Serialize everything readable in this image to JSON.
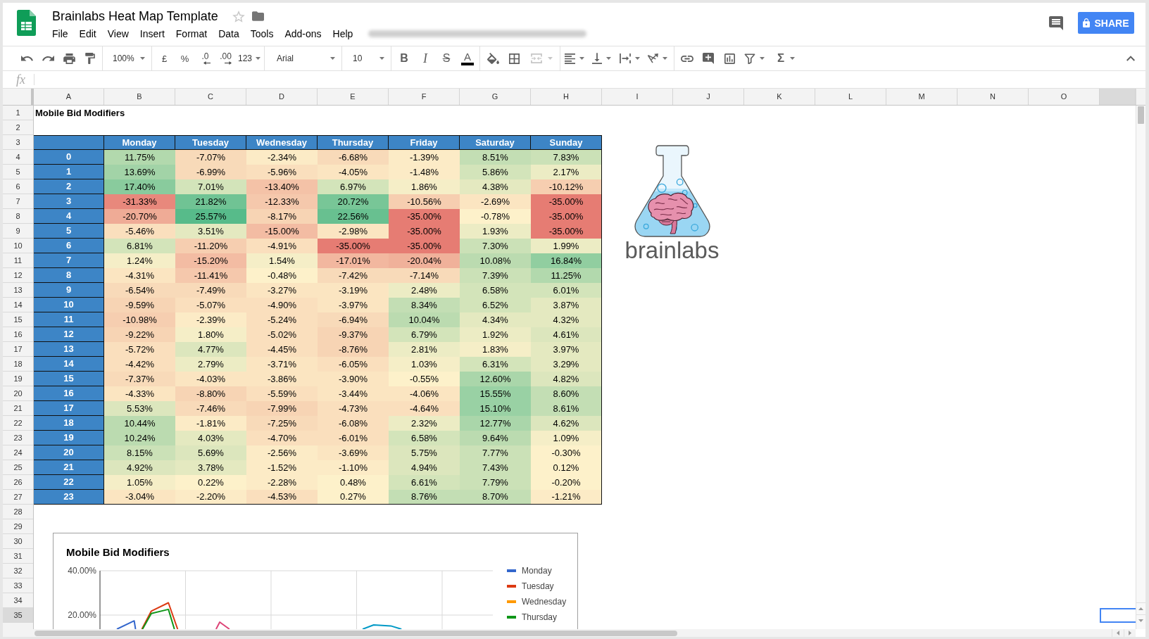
{
  "app": {
    "title": "Brainlabs Heat Map Template",
    "starred": false,
    "share_label": "SHARE"
  },
  "menu": [
    "File",
    "Edit",
    "View",
    "Insert",
    "Format",
    "Data",
    "Tools",
    "Add-ons",
    "Help"
  ],
  "toolbar": {
    "zoom": "100%",
    "currency": "£",
    "percent": "%",
    "decrease_decimals": ".0",
    "increase_decimals": ".00",
    "number_format": "123",
    "font": "Arial",
    "font_size": "10",
    "bold": "B",
    "italic": "I",
    "strikethrough": "S",
    "text_color": "A",
    "merge_disabled": true,
    "functions": "Σ"
  },
  "formula_bar": {
    "label": "fx"
  },
  "sheet": {
    "columns": [
      {
        "label": "A",
        "selected": false
      },
      {
        "label": "B",
        "selected": false
      },
      {
        "label": "C",
        "selected": false
      },
      {
        "label": "D",
        "selected": false
      },
      {
        "label": "E",
        "selected": false
      },
      {
        "label": "F",
        "selected": false
      },
      {
        "label": "G",
        "selected": false
      },
      {
        "label": "H",
        "selected": false
      },
      {
        "label": "I",
        "selected": false
      },
      {
        "label": "J",
        "selected": false
      },
      {
        "label": "K",
        "selected": false
      },
      {
        "label": "L",
        "selected": false
      },
      {
        "label": "M",
        "selected": false
      },
      {
        "label": "N",
        "selected": false
      },
      {
        "label": "O",
        "selected": false
      },
      {
        "selected": true
      }
    ],
    "rows": [
      {
        "label": "1",
        "selected": false
      },
      {
        "label": "2",
        "selected": false
      },
      {
        "label": "3",
        "selected": false
      },
      {
        "label": "4",
        "selected": false
      },
      {
        "label": "5",
        "selected": false
      },
      {
        "label": "6",
        "selected": false
      },
      {
        "label": "7",
        "selected": false
      },
      {
        "label": "8",
        "selected": false
      },
      {
        "label": "9",
        "selected": false
      },
      {
        "label": "10",
        "selected": false
      },
      {
        "label": "11",
        "selected": false
      },
      {
        "label": "12",
        "selected": false
      },
      {
        "label": "13",
        "selected": false
      },
      {
        "label": "14",
        "selected": false
      },
      {
        "label": "15",
        "selected": false
      },
      {
        "label": "16",
        "selected": false
      },
      {
        "label": "17",
        "selected": false
      },
      {
        "label": "18",
        "selected": false
      },
      {
        "label": "19",
        "selected": false
      },
      {
        "label": "20",
        "selected": false
      },
      {
        "label": "21",
        "selected": false
      },
      {
        "label": "22",
        "selected": false
      },
      {
        "label": "23",
        "selected": false
      },
      {
        "label": "24",
        "selected": false
      },
      {
        "label": "25",
        "selected": false
      },
      {
        "label": "26",
        "selected": false
      },
      {
        "label": "27",
        "selected": false
      },
      {
        "label": "28",
        "selected": false
      },
      {
        "label": "29",
        "selected": false
      },
      {
        "label": "30",
        "selected": false
      },
      {
        "label": "31",
        "selected": false
      },
      {
        "label": "32",
        "selected": false
      },
      {
        "label": "33",
        "selected": false
      },
      {
        "label": "34",
        "selected": false
      },
      {
        "label": "35",
        "selected": true
      }
    ],
    "title_cell": "Mobile Bid Modifiers",
    "heat_table": {
      "headers": [
        "Monday",
        "Tuesday",
        "Wednesday",
        "Thursday",
        "Friday",
        "Saturday",
        "Sunday"
      ],
      "rows": [
        {
          "hour": "0",
          "cells": [
            {
              "value": "11.75%",
              "color": "#b2d9ad"
            },
            {
              "value": "-7.07%",
              "color": "#f8dab9"
            },
            {
              "value": "-2.34%",
              "color": "#fcebc6"
            },
            {
              "value": "-6.68%",
              "color": "#f8dab9"
            },
            {
              "value": "-1.39%",
              "color": "#fcebc6"
            },
            {
              "value": "8.51%",
              "color": "#c3deb4"
            },
            {
              "value": "7.83%",
              "color": "#cbe1b7"
            }
          ]
        },
        {
          "hour": "1",
          "cells": [
            {
              "value": "13.69%",
              "color": "#a2d3a7"
            },
            {
              "value": "-6.99%",
              "color": "#f8dab9"
            },
            {
              "value": "-5.96%",
              "color": "#fadfbd"
            },
            {
              "value": "-4.05%",
              "color": "#fbe5c1"
            },
            {
              "value": "-1.48%",
              "color": "#fcebc6"
            },
            {
              "value": "5.86%",
              "color": "#d3e4ba"
            },
            {
              "value": "2.17%",
              "color": "#ececc4"
            }
          ]
        },
        {
          "hour": "2",
          "cells": [
            {
              "value": "17.40%",
              "color": "#89cb9d"
            },
            {
              "value": "7.01%",
              "color": "#d3e4ba"
            },
            {
              "value": "-13.40%",
              "color": "#f4c2a7"
            },
            {
              "value": "6.97%",
              "color": "#d3e4ba"
            },
            {
              "value": "1.86%",
              "color": "#f5eec7"
            },
            {
              "value": "4.38%",
              "color": "#e4e9c0"
            },
            {
              "value": "-10.12%",
              "color": "#f6ceb0"
            }
          ]
        },
        {
          "hour": "3",
          "cells": [
            {
              "value": "-31.33%",
              "color": "#e8887c"
            },
            {
              "value": "21.82%",
              "color": "#70c394"
            },
            {
              "value": "-12.33%",
              "color": "#f5c8ac"
            },
            {
              "value": "20.72%",
              "color": "#78c697"
            },
            {
              "value": "-10.56%",
              "color": "#f6ceb0"
            },
            {
              "value": "-2.69%",
              "color": "#fbe5c1"
            },
            {
              "value": "-35.00%",
              "color": "#e67c73"
            }
          ]
        },
        {
          "hour": "4",
          "cells": [
            {
              "value": "-20.70%",
              "color": "#efab96"
            },
            {
              "value": "25.57%",
              "color": "#57bb8a"
            },
            {
              "value": "-8.17%",
              "color": "#f7d4b4"
            },
            {
              "value": "22.56%",
              "color": "#68c090"
            },
            {
              "value": "-35.00%",
              "color": "#e67c73"
            },
            {
              "value": "-0.78%",
              "color": "#fdf1ca"
            },
            {
              "value": "-35.00%",
              "color": "#e67c73"
            }
          ]
        },
        {
          "hour": "5",
          "cells": [
            {
              "value": "-5.46%",
              "color": "#fadfbd"
            },
            {
              "value": "3.51%",
              "color": "#e4e9c0"
            },
            {
              "value": "-15.00%",
              "color": "#f3bca3"
            },
            {
              "value": "-2.98%",
              "color": "#fbe5c1"
            },
            {
              "value": "-35.00%",
              "color": "#e67c73"
            },
            {
              "value": "1.93%",
              "color": "#ececc4"
            },
            {
              "value": "-35.00%",
              "color": "#e67c73"
            }
          ]
        },
        {
          "hour": "6",
          "cells": [
            {
              "value": "6.81%",
              "color": "#d3e4ba"
            },
            {
              "value": "-11.20%",
              "color": "#f6ceb0"
            },
            {
              "value": "-4.91%",
              "color": "#fadfbd"
            },
            {
              "value": "-35.00%",
              "color": "#e67c73"
            },
            {
              "value": "-35.00%",
              "color": "#e67c73"
            },
            {
              "value": "7.30%",
              "color": "#cbe1b7"
            },
            {
              "value": "1.99%",
              "color": "#ececc4"
            }
          ]
        },
        {
          "hour": "7",
          "cells": [
            {
              "value": "1.24%",
              "color": "#f5eec7"
            },
            {
              "value": "-15.20%",
              "color": "#f3bca3"
            },
            {
              "value": "1.54%",
              "color": "#f5eec7"
            },
            {
              "value": "-17.01%",
              "color": "#f2b79f"
            },
            {
              "value": "-20.04%",
              "color": "#f0b19a"
            },
            {
              "value": "10.08%",
              "color": "#bbdbb0"
            },
            {
              "value": "16.84%",
              "color": "#91cea0"
            }
          ]
        },
        {
          "hour": "8",
          "cells": [
            {
              "value": "-4.31%",
              "color": "#fbe5c1"
            },
            {
              "value": "-11.41%",
              "color": "#f5c8ac"
            },
            {
              "value": "-0.48%",
              "color": "#fdf1ca"
            },
            {
              "value": "-7.42%",
              "color": "#f8dab9"
            },
            {
              "value": "-7.14%",
              "color": "#f8dab9"
            },
            {
              "value": "7.39%",
              "color": "#cbe1b7"
            },
            {
              "value": "11.25%",
              "color": "#b2d9ad"
            }
          ]
        },
        {
          "hour": "9",
          "cells": [
            {
              "value": "-6.54%",
              "color": "#f8dab9"
            },
            {
              "value": "-7.49%",
              "color": "#f8dab9"
            },
            {
              "value": "-3.27%",
              "color": "#fbe5c1"
            },
            {
              "value": "-3.19%",
              "color": "#fbe5c1"
            },
            {
              "value": "2.48%",
              "color": "#ececc4"
            },
            {
              "value": "6.58%",
              "color": "#d3e4ba"
            },
            {
              "value": "6.01%",
              "color": "#d3e4ba"
            }
          ]
        },
        {
          "hour": "10",
          "cells": [
            {
              "value": "-9.59%",
              "color": "#f7d4b4"
            },
            {
              "value": "-5.07%",
              "color": "#fadfbd"
            },
            {
              "value": "-4.90%",
              "color": "#fadfbd"
            },
            {
              "value": "-3.97%",
              "color": "#fbe5c1"
            },
            {
              "value": "8.34%",
              "color": "#c3deb4"
            },
            {
              "value": "6.52%",
              "color": "#d3e4ba"
            },
            {
              "value": "3.87%",
              "color": "#e4e9c0"
            }
          ]
        },
        {
          "hour": "11",
          "cells": [
            {
              "value": "-10.98%",
              "color": "#f6ceb0"
            },
            {
              "value": "-2.39%",
              "color": "#fcebc6"
            },
            {
              "value": "-5.24%",
              "color": "#fadfbd"
            },
            {
              "value": "-6.94%",
              "color": "#f8dab9"
            },
            {
              "value": "10.04%",
              "color": "#bbdbb0"
            },
            {
              "value": "4.34%",
              "color": "#e4e9c0"
            },
            {
              "value": "4.32%",
              "color": "#e4e9c0"
            }
          ]
        },
        {
          "hour": "12",
          "cells": [
            {
              "value": "-9.22%",
              "color": "#f7d4b4"
            },
            {
              "value": "1.80%",
              "color": "#f5eec7"
            },
            {
              "value": "-5.02%",
              "color": "#fadfbd"
            },
            {
              "value": "-9.37%",
              "color": "#f7d4b4"
            },
            {
              "value": "6.79%",
              "color": "#d3e4ba"
            },
            {
              "value": "1.92%",
              "color": "#ececc4"
            },
            {
              "value": "4.61%",
              "color": "#dce6bd"
            }
          ]
        },
        {
          "hour": "13",
          "cells": [
            {
              "value": "-5.72%",
              "color": "#fadfbd"
            },
            {
              "value": "4.77%",
              "color": "#dce6bd"
            },
            {
              "value": "-4.45%",
              "color": "#fadfbd"
            },
            {
              "value": "-8.76%",
              "color": "#f7d4b4"
            },
            {
              "value": "2.81%",
              "color": "#ececc4"
            },
            {
              "value": "1.83%",
              "color": "#f5eec7"
            },
            {
              "value": "3.97%",
              "color": "#e4e9c0"
            }
          ]
        },
        {
          "hour": "14",
          "cells": [
            {
              "value": "-4.42%",
              "color": "#fadfbd"
            },
            {
              "value": "2.79%",
              "color": "#ececc4"
            },
            {
              "value": "-3.71%",
              "color": "#fbe5c1"
            },
            {
              "value": "-6.05%",
              "color": "#fadfbd"
            },
            {
              "value": "1.03%",
              "color": "#f5eec7"
            },
            {
              "value": "6.31%",
              "color": "#d3e4ba"
            },
            {
              "value": "3.29%",
              "color": "#e4e9c0"
            }
          ]
        },
        {
          "hour": "15",
          "cells": [
            {
              "value": "-7.37%",
              "color": "#f8dab9"
            },
            {
              "value": "-4.03%",
              "color": "#fbe5c1"
            },
            {
              "value": "-3.86%",
              "color": "#fbe5c1"
            },
            {
              "value": "-3.90%",
              "color": "#fbe5c1"
            },
            {
              "value": "-0.55%",
              "color": "#fdf1ca"
            },
            {
              "value": "12.60%",
              "color": "#aad6aa"
            },
            {
              "value": "4.82%",
              "color": "#dce6bd"
            }
          ]
        },
        {
          "hour": "16",
          "cells": [
            {
              "value": "-4.33%",
              "color": "#fbe5c1"
            },
            {
              "value": "-8.80%",
              "color": "#f7d4b4"
            },
            {
              "value": "-5.59%",
              "color": "#fadfbd"
            },
            {
              "value": "-3.44%",
              "color": "#fbe5c1"
            },
            {
              "value": "-4.06%",
              "color": "#fbe5c1"
            },
            {
              "value": "15.55%",
              "color": "#99d1a4"
            },
            {
              "value": "8.60%",
              "color": "#c3deb4"
            }
          ]
        },
        {
          "hour": "17",
          "cells": [
            {
              "value": "5.53%",
              "color": "#dce6bd"
            },
            {
              "value": "-7.46%",
              "color": "#f8dab9"
            },
            {
              "value": "-7.99%",
              "color": "#f7d4b4"
            },
            {
              "value": "-4.73%",
              "color": "#fadfbd"
            },
            {
              "value": "-4.64%",
              "color": "#fadfbd"
            },
            {
              "value": "15.10%",
              "color": "#99d1a4"
            },
            {
              "value": "8.61%",
              "color": "#c3deb4"
            }
          ]
        },
        {
          "hour": "18",
          "cells": [
            {
              "value": "10.44%",
              "color": "#bbdbb0"
            },
            {
              "value": "-1.81%",
              "color": "#fcebc6"
            },
            {
              "value": "-7.25%",
              "color": "#f8dab9"
            },
            {
              "value": "-6.08%",
              "color": "#fadfbd"
            },
            {
              "value": "2.32%",
              "color": "#ececc4"
            },
            {
              "value": "12.77%",
              "color": "#aad6aa"
            },
            {
              "value": "4.62%",
              "color": "#dce6bd"
            }
          ]
        },
        {
          "hour": "19",
          "cells": [
            {
              "value": "10.24%",
              "color": "#bbdbb0"
            },
            {
              "value": "4.03%",
              "color": "#e4e9c0"
            },
            {
              "value": "-4.70%",
              "color": "#fadfbd"
            },
            {
              "value": "-6.01%",
              "color": "#fadfbd"
            },
            {
              "value": "6.58%",
              "color": "#d3e4ba"
            },
            {
              "value": "9.64%",
              "color": "#bbdbb0"
            },
            {
              "value": "1.09%",
              "color": "#f5eec7"
            }
          ]
        },
        {
          "hour": "20",
          "cells": [
            {
              "value": "8.15%",
              "color": "#cbe1b7"
            },
            {
              "value": "5.69%",
              "color": "#dce6bd"
            },
            {
              "value": "-2.56%",
              "color": "#fcebc6"
            },
            {
              "value": "-3.69%",
              "color": "#fbe5c1"
            },
            {
              "value": "5.75%",
              "color": "#dce6bd"
            },
            {
              "value": "7.77%",
              "color": "#cbe1b7"
            },
            {
              "value": "-0.30%",
              "color": "#fdf1ca"
            }
          ]
        },
        {
          "hour": "21",
          "cells": [
            {
              "value": "4.92%",
              "color": "#dce6bd"
            },
            {
              "value": "3.78%",
              "color": "#e4e9c0"
            },
            {
              "value": "-1.52%",
              "color": "#fcebc6"
            },
            {
              "value": "-1.10%",
              "color": "#fcebc6"
            },
            {
              "value": "4.94%",
              "color": "#dce6bd"
            },
            {
              "value": "7.43%",
              "color": "#cbe1b7"
            },
            {
              "value": "0.12%",
              "color": "#fdf1ca"
            }
          ]
        },
        {
          "hour": "22",
          "cells": [
            {
              "value": "1.05%",
              "color": "#f5eec7"
            },
            {
              "value": "0.22%",
              "color": "#fdf1ca"
            },
            {
              "value": "-2.28%",
              "color": "#fcebc6"
            },
            {
              "value": "0.48%",
              "color": "#fdf1ca"
            },
            {
              "value": "6.61%",
              "color": "#d3e4ba"
            },
            {
              "value": "7.79%",
              "color": "#cbe1b7"
            },
            {
              "value": "-0.20%",
              "color": "#fdf1ca"
            }
          ]
        },
        {
          "hour": "23",
          "cells": [
            {
              "value": "-3.04%",
              "color": "#fbe5c1"
            },
            {
              "value": "-2.20%",
              "color": "#fcebc6"
            },
            {
              "value": "-4.53%",
              "color": "#fadfbd"
            },
            {
              "value": "0.27%",
              "color": "#fdf1ca"
            },
            {
              "value": "8.76%",
              "color": "#c3deb4"
            },
            {
              "value": "8.70%",
              "color": "#c3deb4"
            },
            {
              "value": "-1.21%",
              "color": "#fcebc6"
            }
          ]
        }
      ]
    }
  },
  "logo": {
    "text": "brainlabs"
  },
  "chart": {
    "title": "Mobile Bid Modifiers",
    "y_tick_labels": [
      "40.00%",
      "20.00%"
    ],
    "legend": [
      {
        "name": "Monday",
        "color": "#3366cc"
      },
      {
        "name": "Tuesday",
        "color": "#dc3912"
      },
      {
        "name": "Wednesday",
        "color": "#ff9900"
      },
      {
        "name": "Thursday",
        "color": "#109618"
      }
    ]
  }
}
